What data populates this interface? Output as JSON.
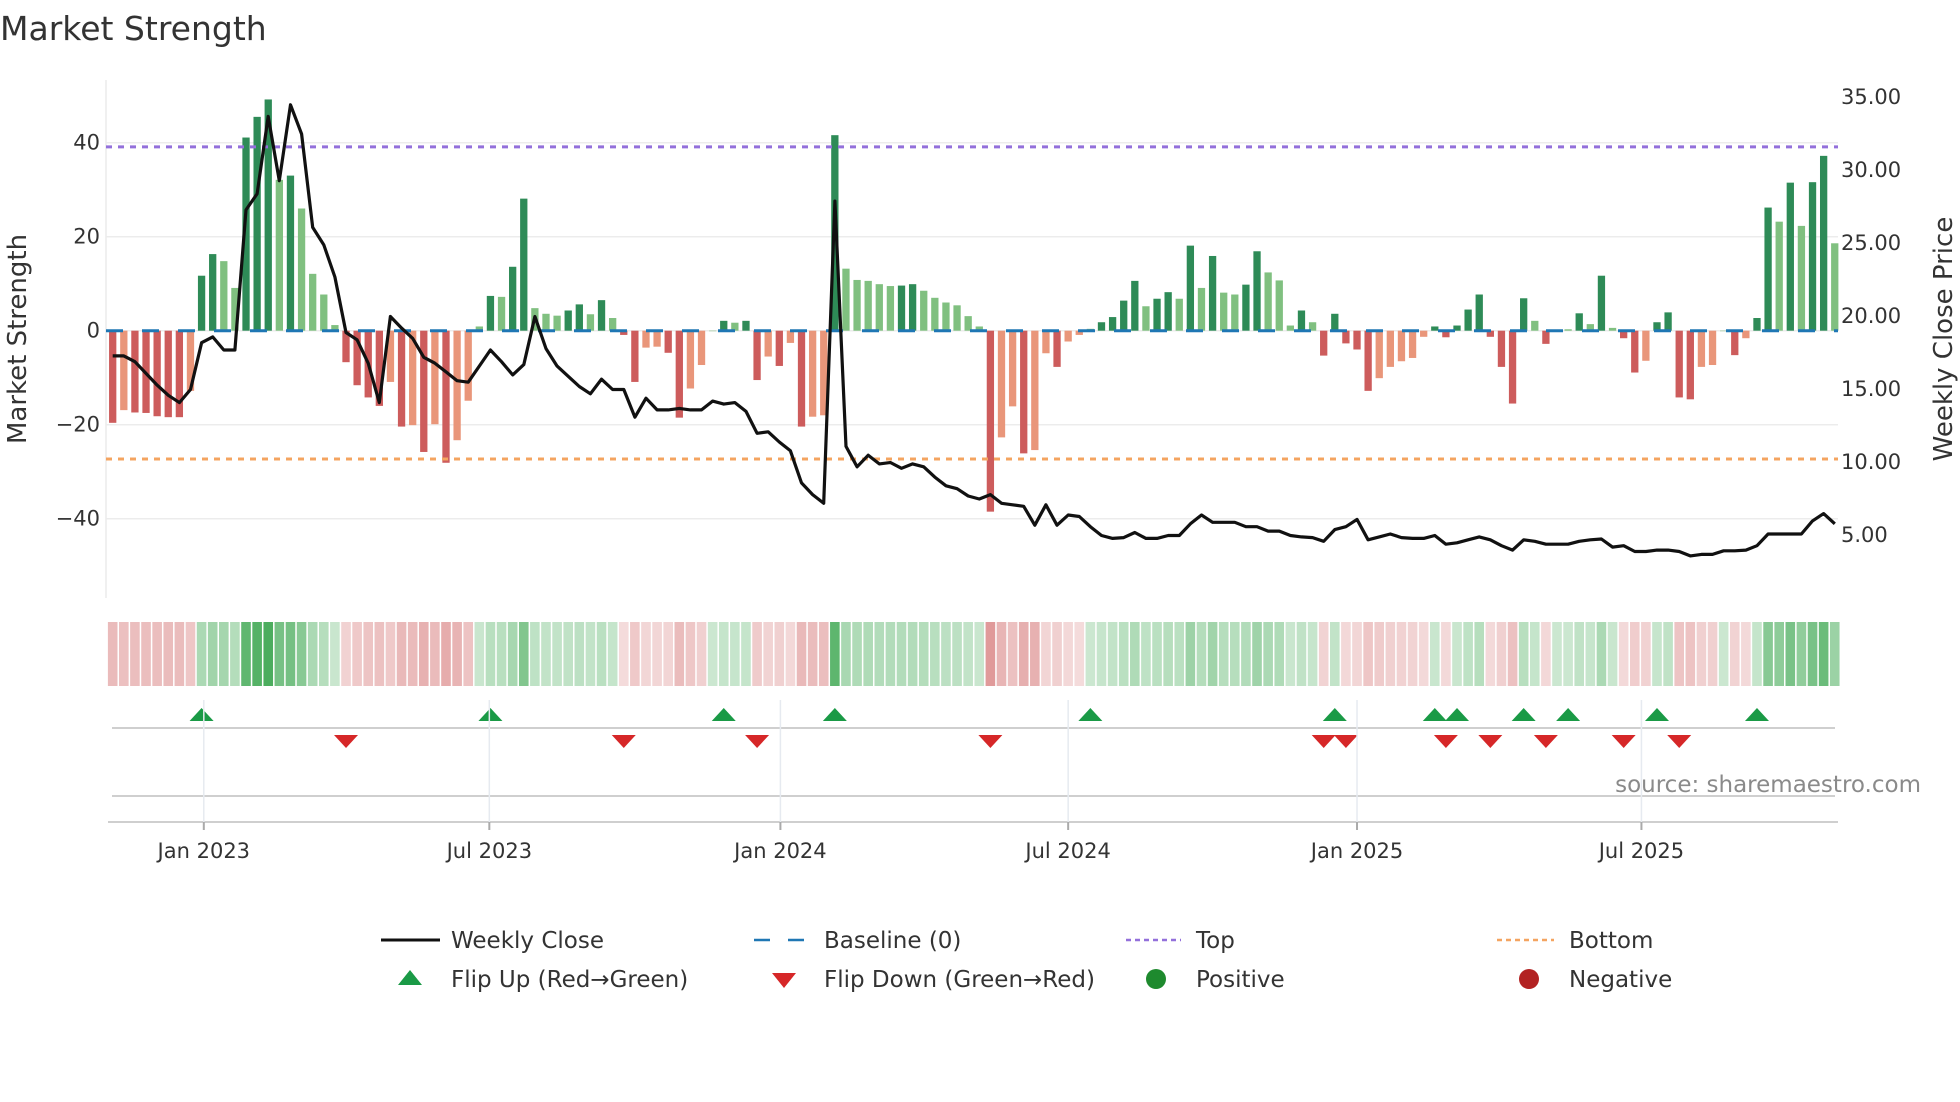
{
  "chart_data": {
    "type": "bar",
    "title": "Market Strength",
    "ylabel": "Market Strength",
    "y2label": "Weekly Close Price",
    "ylim": [
      -52,
      54
    ],
    "y2lim": [
      1.7,
      36.8
    ],
    "yticks": [
      40,
      20,
      0,
      -20,
      -40
    ],
    "yticklabels": [
      "40",
      "20",
      "0",
      "−20",
      "−40"
    ],
    "y2ticks": [
      35,
      30,
      25,
      20,
      15,
      10,
      5
    ],
    "y2ticklabels": [
      "35.00",
      "30.00",
      "25.00",
      "20.00",
      "15.00",
      "10.00",
      "5.00"
    ],
    "x_unit": "week index",
    "xticks": [
      9.2,
      34.9,
      61.1,
      87.0,
      113.0,
      138.6
    ],
    "xticklabels": [
      "Jan 2023",
      "Jul 2023",
      "Jan 2024",
      "Jul 2024",
      "Jan 2025",
      "Jul 2025"
    ],
    "top_level": 39.1,
    "bottom_level": -27.3,
    "baseline": 0,
    "grid": true,
    "legend_position": "bottom",
    "strength": [
      -19.6,
      -16.9,
      -17.4,
      -17.5,
      -18.2,
      -18.4,
      -18.4,
      -12.8,
      11.7,
      16.3,
      14.8,
      9.1,
      41.1,
      45.5,
      49.2,
      32.1,
      33.0,
      26.0,
      12.1,
      7.7,
      1.2,
      -6.7,
      -11.6,
      -14.2,
      -16.0,
      -10.9,
      -20.4,
      -20.1,
      -25.8,
      -19.9,
      -28.1,
      -23.3,
      -14.9,
      0.9,
      7.4,
      7.2,
      13.6,
      28.1,
      4.8,
      3.6,
      3.2,
      4.3,
      5.6,
      3.5,
      6.5,
      2.7,
      -0.9,
      -10.9,
      -3.6,
      -3.4,
      -4.7,
      -18.5,
      -12.3,
      -7.3,
      0,
      2.1,
      1.7,
      2.1,
      -10.5,
      -5.5,
      -7.5,
      -2.6,
      -20.4,
      -18.3,
      -18.0,
      41.6,
      13.2,
      10.8,
      10.6,
      9.9,
      9.5,
      9.6,
      9.9,
      8.5,
      7.0,
      6.0,
      5.4,
      3.1,
      0.9,
      -38.5,
      -22.7,
      -16.1,
      -26.1,
      -25.4,
      -4.8,
      -7.7,
      -2.3,
      -0.9,
      0.4,
      1.8,
      2.9,
      6.4,
      10.6,
      5.2,
      6.8,
      8.2,
      6.8,
      18.1,
      9.1,
      15.9,
      8.1,
      7.7,
      9.8,
      16.9,
      12.4,
      10.7,
      1.1,
      4.3,
      1.8,
      -5.3,
      3.6,
      -2.7,
      -4.0,
      -12.8,
      -10.1,
      -7.7,
      -6.5,
      -5.8,
      -1.3,
      0.9,
      -1.4,
      1.1,
      4.5,
      7.7,
      -1.3,
      -7.7,
      -15.5,
      6.9,
      2.1,
      -2.8,
      0,
      0.3,
      3.7,
      1.4,
      11.7,
      0.6,
      -1.6,
      -8.9,
      -6.4,
      1.8,
      3.9,
      -14.2,
      -14.6,
      -7.7,
      -7.3,
      0,
      -5.2,
      -1.6,
      2.7,
      26.2,
      23.2,
      31.5,
      22.3,
      31.6,
      37.2,
      18.6
    ],
    "tone": "DLDDDDDLDDLLDDDLDLLLLDDDDLDLDLDLLLDLDDLLLDDLDLDDLLDDLLLDLDDLDLDLLDLLLLLDDLLLLLLDLLDLLDLLLDDDDLDDLDLDLLDDLLLDLDDDDDLLLLLDDDDDDDDDLDLLDLDLDDLDDDDLLLDLDDLDLDDL",
    "weekly_close": [
      17.2,
      17.2,
      16.8,
      16.0,
      15.2,
      14.5,
      14.0,
      14.9,
      18.1,
      18.5,
      17.6,
      17.6,
      27.2,
      28.3,
      33.6,
      29.2,
      34.4,
      32.4,
      26.0,
      24.8,
      22.6,
      18.8,
      18.3,
      16.7,
      14.0,
      19.9,
      19.1,
      18.4,
      17.1,
      16.7,
      16.1,
      15.5,
      15.4,
      16.5,
      17.6,
      16.8,
      15.9,
      16.6,
      19.9,
      17.7,
      16.5,
      15.8,
      15.1,
      14.6,
      15.6,
      14.9,
      14.9,
      13.0,
      14.3,
      13.5,
      13.5,
      13.6,
      13.5,
      13.5,
      14.1,
      13.9,
      14.0,
      13.4,
      11.9,
      12.0,
      11.3,
      10.7,
      8.5,
      7.7,
      7.1,
      27.8,
      11.0,
      9.6,
      10.4,
      9.8,
      9.9,
      9.5,
      9.8,
      9.6,
      8.9,
      8.3,
      8.1,
      7.6,
      7.4,
      7.7,
      7.1,
      7.0,
      6.9,
      5.6,
      7.0,
      5.6,
      6.3,
      6.2,
      5.5,
      4.9,
      4.7,
      4.75,
      5.1,
      4.7,
      4.7,
      4.9,
      4.9,
      5.7,
      6.3,
      5.8,
      5.8,
      5.8,
      5.5,
      5.5,
      5.2,
      5.2,
      4.9,
      4.8,
      4.75,
      4.5,
      5.3,
      5.5,
      6.0,
      4.6,
      4.8,
      5.0,
      4.75,
      4.7,
      4.7,
      4.9,
      4.3,
      4.4,
      4.6,
      4.8,
      4.6,
      4.2,
      3.9,
      4.6,
      4.5,
      4.3,
      4.3,
      4.3,
      4.5,
      4.6,
      4.66,
      4.1,
      4.2,
      3.8,
      3.8,
      3.9,
      3.9,
      3.8,
      3.5,
      3.6,
      3.6,
      3.85,
      3.85,
      3.9,
      4.2,
      5.0,
      5.0,
      5.0,
      5.0,
      5.9,
      6.4,
      5.7
    ],
    "flip_up_weeks": [
      9,
      35,
      56,
      66,
      89,
      111,
      120,
      122,
      128,
      132,
      140,
      149
    ],
    "flip_down_weeks": [
      22,
      47,
      59,
      80,
      110,
      112,
      121,
      125,
      130,
      137,
      142
    ],
    "source": "source: sharemaestro.com"
  },
  "legend": {
    "weekly_close": "Weekly Close",
    "baseline": "Baseline (0)",
    "top": "Top",
    "bottom": "Bottom",
    "flip_up": "Flip Up (Red→Green)",
    "flip_down": "Flip Down (Green→Red)",
    "positive": "Positive",
    "negative": "Negative"
  },
  "colors": {
    "pos_strong": "#2e8b57",
    "pos_weak": "#80c080",
    "neg_strong": "#cd5c5c",
    "neg_weak": "#e9967a",
    "price": "#111111",
    "baseline": "#1f77b4",
    "top": "#9370db",
    "bottom": "#f4a460",
    "flip_up": "#1a9a46",
    "flip_down": "#d62728",
    "positive_dot": "#1e8a2e",
    "negative_dot": "#b22222"
  }
}
